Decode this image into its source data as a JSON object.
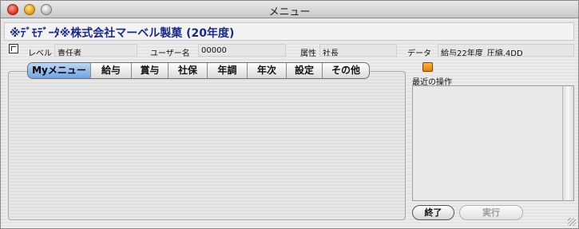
{
  "window": {
    "title": "メニュー"
  },
  "banner": {
    "text": "※ﾃﾞﾓﾃﾞｰﾀ※株式会社マーベル製菓 (20年度)"
  },
  "info": {
    "level_label": "レベル",
    "level_value": "責任者",
    "user_label": "ユーザー名",
    "user_value": "00000",
    "attr_label": "属性",
    "attr_value": "社長",
    "data_label": "データ",
    "data_value": "給与22年度_圧縮.4DD"
  },
  "tabs": [
    {
      "label": "Myメニュー",
      "active": true
    },
    {
      "label": "給与"
    },
    {
      "label": "賞与"
    },
    {
      "label": "社保"
    },
    {
      "label": "年調"
    },
    {
      "label": "年次"
    },
    {
      "label": "設定"
    },
    {
      "label": "その他"
    }
  ],
  "recent": {
    "label": "最近の操作"
  },
  "buttons": {
    "end": "終了",
    "run": "実行"
  },
  "colors": {
    "accent": "#6ea4e3",
    "banner_text": "#1a2a8a",
    "recent_icon": "#f07a00"
  }
}
